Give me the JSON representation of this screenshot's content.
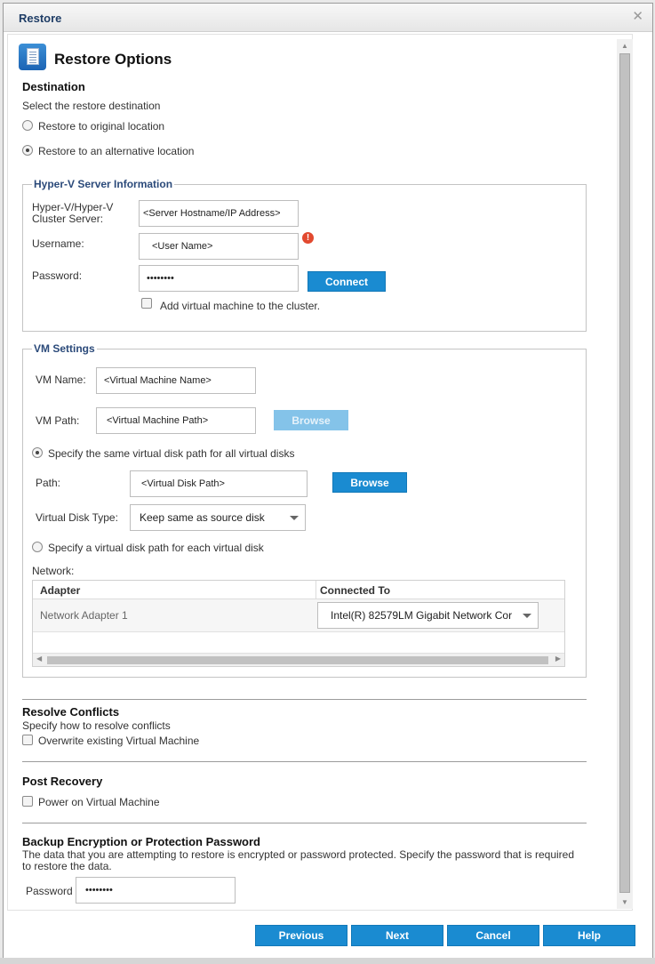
{
  "window": {
    "title": "Restore",
    "close_glyph": "✕"
  },
  "header": {
    "title": "Restore Options",
    "icon": "restore-document-icon"
  },
  "destination": {
    "heading": "Destination",
    "prompt": "Select the restore destination",
    "option_original": "Restore to original location",
    "option_alternative": "Restore to an alternative location",
    "selected": "alternative"
  },
  "hyperv": {
    "legend": "Hyper-V Server Information",
    "server_label_line1": "Hyper-V/Hyper-V",
    "server_label_line2": "Cluster Server:",
    "server_value": "<Server Hostname/IP Address>",
    "username_label": "Username:",
    "username_value": "<User Name>",
    "warning_glyph": "!",
    "password_label": "Password:",
    "password_value": "••••••••",
    "connect_button": "Connect",
    "add_to_cluster_label": "Add virtual machine to the cluster.",
    "add_to_cluster_checked": false
  },
  "vm": {
    "legend": "VM Settings",
    "name_label": "VM Name:",
    "name_value": "<Virtual Machine Name>",
    "path_label": "VM Path:",
    "path_value": "<Virtual Machine Path>",
    "browse_disabled_label": "Browse",
    "same_path_option": "Specify the same virtual disk path for all virtual disks",
    "disk_path_label": "Path:",
    "disk_path_value": "<Virtual Disk Path>",
    "browse_label": "Browse",
    "disk_type_label": "Virtual Disk Type:",
    "disk_type_value": "Keep same as source disk",
    "each_path_option": "Specify a virtual disk path for each virtual disk",
    "selected_disk_option": "same"
  },
  "network": {
    "label": "Network:",
    "columns": [
      "Adapter",
      "Connected To"
    ],
    "rows": [
      {
        "adapter": "Network Adapter 1",
        "connected_to": "Intel(R) 82579LM Gigabit Network Cor"
      }
    ]
  },
  "conflicts": {
    "heading": "Resolve Conflicts",
    "prompt": "Specify how to resolve conflicts",
    "overwrite_label": "Overwrite existing Virtual Machine",
    "overwrite_checked": false
  },
  "post_recovery": {
    "heading": "Post Recovery",
    "power_on_label": "Power on Virtual Machine",
    "power_on_checked": false
  },
  "encryption": {
    "heading": "Backup Encryption or Protection Password",
    "description_line1": "The data that you are attempting to restore is encrypted or password protected. Specify the password that is required",
    "description_line2": "to restore the data.",
    "password_label": "Password",
    "password_value": "••••••••"
  },
  "footer": {
    "previous": "Previous",
    "next": "Next",
    "cancel": "Cancel",
    "help": "Help"
  },
  "colors": {
    "primary_button": "#1a8bd1",
    "disabled_button": "#84c3e9",
    "legend_text": "#2b4a7a",
    "warning": "#e2492f"
  }
}
